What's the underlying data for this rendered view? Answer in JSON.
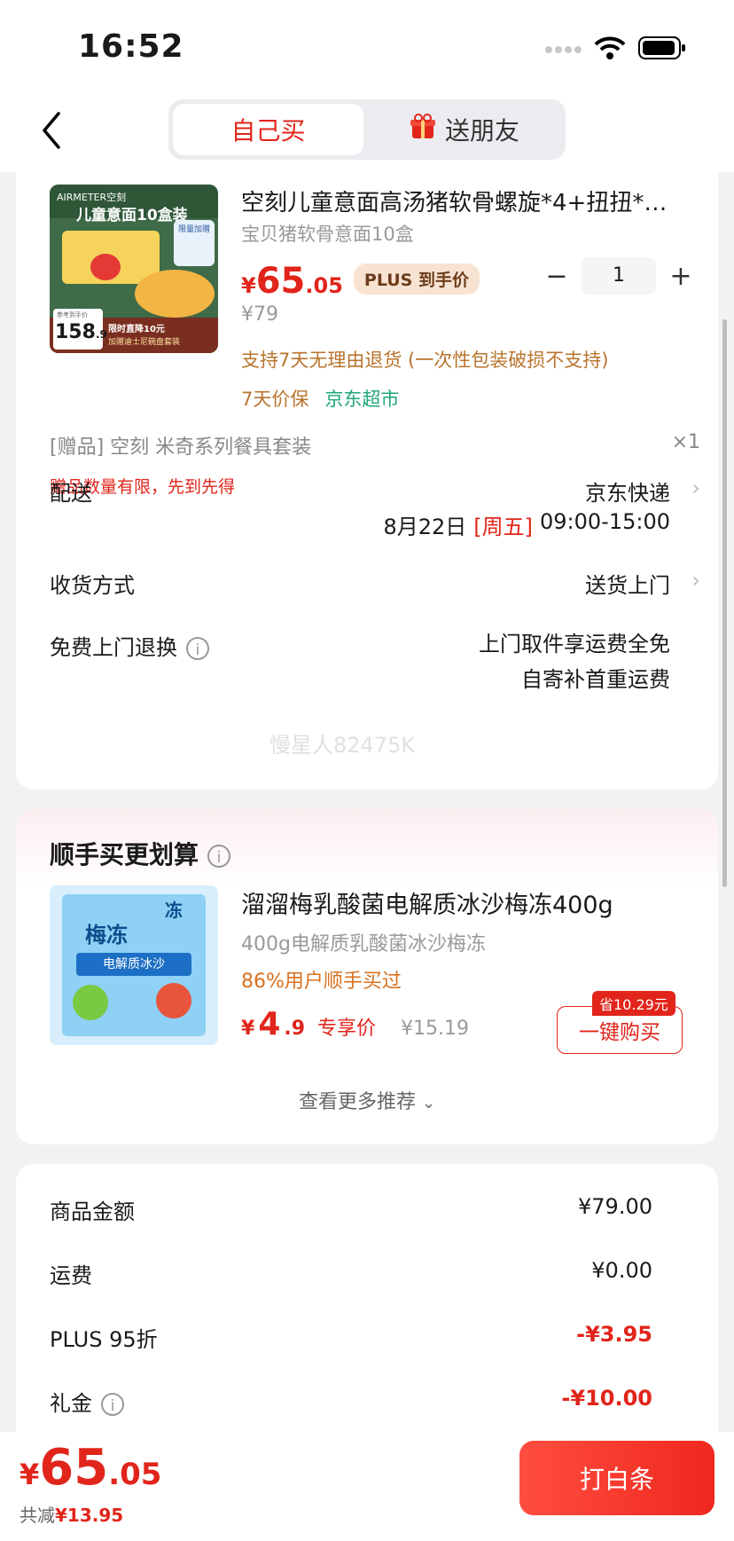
{
  "status_bar": {
    "time": "16:52"
  },
  "nav": {
    "tab_self": "自己买",
    "tab_gift": "送朋友"
  },
  "product": {
    "title": "空刻儿童意面高汤猪软骨螺旋*4+扭扭*…",
    "subtitle": "宝贝猪软骨意面10盒",
    "price_yen": "¥",
    "price_int": "65",
    "price_dec": ".05",
    "plus_badge": "PLUS 到手价",
    "original_price": "¥79",
    "quantity": "1",
    "service_return": "支持7天无理由退货 (一次性包装破损不支持)",
    "service_price_protect": "7天价保",
    "service_store": "京东超市",
    "image": {
      "brand": "AIRMETER空刻",
      "headline": "儿童意面10盒装",
      "badge": "限量加赠",
      "ref_price_label": "参考到手价",
      "ref_price_int": "158",
      "ref_price_dec": ".9",
      "promo_line1": "限时直降10元",
      "promo_line2": "加赠迪士尼碗盘套装"
    }
  },
  "gift": {
    "text": "[赠品]  空刻  米奇系列餐具套装",
    "qty": "×1",
    "note": "赠品数量有限，先到先得"
  },
  "delivery": {
    "label": "配送",
    "carrier": "京东快递",
    "date": "8月22日",
    "weekday": "[周五]",
    "time": "09:00-15:00"
  },
  "receive": {
    "label": "收货方式",
    "value": "送货上门"
  },
  "free_return": {
    "label": "免费上门退换",
    "line1": "上门取件享运费全免",
    "line2": "自寄补首重运费"
  },
  "watermark": "慢星人82475K",
  "recommend": {
    "title": "顺手买更划算",
    "item_title": "溜溜梅乳酸菌电解质冰沙梅冻400g",
    "item_sub": "400g电解质乳酸菌冰沙梅冻",
    "item_stat": "86%用户顺手买过",
    "price_yen": "¥",
    "price_int": "4",
    "price_dec": ".9",
    "price_tag": "专享价",
    "orig_price": "¥15.19",
    "save_tag": "省10.29元",
    "buy_label": "一键购买",
    "more_label": "查看更多推荐",
    "image": {
      "title": "梅冻",
      "corner": "冻",
      "sub": "电解质冰沙"
    }
  },
  "fees": [
    {
      "label": "商品金额",
      "value": "¥79.00"
    },
    {
      "label": "运费",
      "value": "¥0.00"
    },
    {
      "label": "PLUS 95折",
      "value": "-¥3.95"
    },
    {
      "label": "礼金",
      "value": "-¥10.00"
    }
  ],
  "bottom": {
    "total_yen": "¥",
    "total_int": "65",
    "total_dec": ".05",
    "saved_prefix": "共减",
    "saved_amount": "¥13.95",
    "pay_label": "打白条"
  },
  "colors": {
    "accent": "#e1251b",
    "gold": "#b8742d",
    "green": "#1fa67a"
  }
}
